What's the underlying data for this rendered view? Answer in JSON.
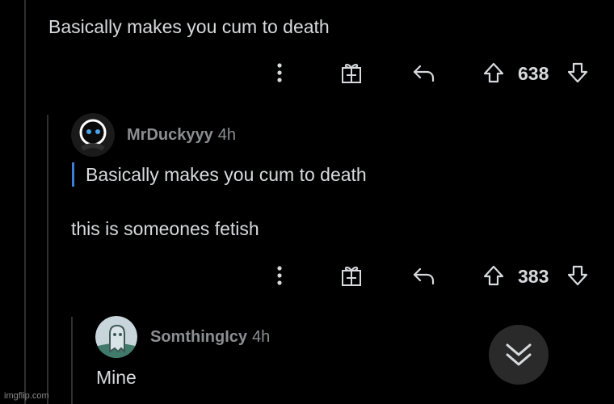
{
  "comments": [
    {
      "text": "Basically makes you cum to death",
      "score": "638",
      "icons": [
        "more-vertical-icon",
        "gift-icon",
        "reply-arrow-icon",
        "upvote-arrow-icon",
        "downvote-arrow-icon"
      ]
    },
    {
      "username": "MrDuckyyy",
      "time": "4h",
      "quote": "Basically makes you cum to death",
      "text": "this is someones fetish",
      "score": "383",
      "avatar_colors": {
        "background": "#1a1a1a",
        "face": "#ffffff",
        "eye": "#4aa3e8"
      }
    },
    {
      "username": "SomthingIcy",
      "time": "4h",
      "text": "Mine",
      "avatar_colors": {
        "background": "#c8d6dc",
        "figure": "#3f7a6a"
      }
    }
  ],
  "colors": {
    "quote_bar": "#3d7fd6",
    "text": "#d7dadc",
    "muted": "#8b8f92",
    "background": "#000000"
  },
  "scroll_down_icon": "double-chevron-down-icon",
  "watermark": "imgflip.com"
}
